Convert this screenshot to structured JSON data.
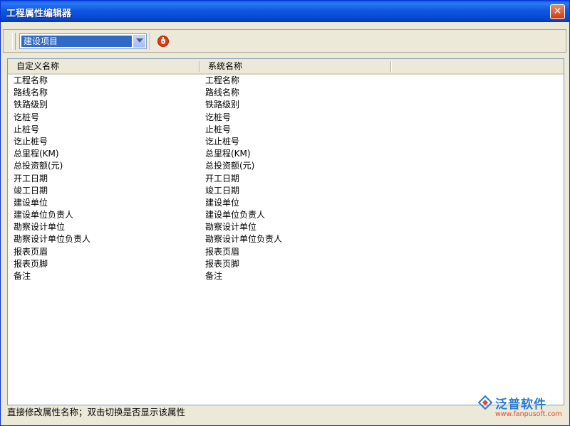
{
  "window": {
    "title": "工程属性编辑器"
  },
  "toolbar": {
    "selected_category": "建设项目"
  },
  "table": {
    "headers": [
      "自定义名称",
      "系统名称"
    ],
    "rows": [
      [
        "工程名称",
        "工程名称"
      ],
      [
        "路线名称",
        "路线名称"
      ],
      [
        "铁路级别",
        "铁路级别"
      ],
      [
        "讫桩号",
        "讫桩号"
      ],
      [
        "止桩号",
        "止桩号"
      ],
      [
        "讫止桩号",
        "讫止桩号"
      ],
      [
        "总里程(KM)",
        "总里程(KM)"
      ],
      [
        "总投资额(元)",
        "总投资额(元)"
      ],
      [
        "开工日期",
        "开工日期"
      ],
      [
        "竣工日期",
        "竣工日期"
      ],
      [
        "建设单位",
        "建设单位"
      ],
      [
        "建设单位负责人",
        "建设单位负责人"
      ],
      [
        "勘察设计单位",
        "勘察设计单位"
      ],
      [
        "勘察设计单位负责人",
        "勘察设计单位负责人"
      ],
      [
        "报表页眉",
        "报表页眉"
      ],
      [
        "报表页脚",
        "报表页脚"
      ],
      [
        "备注",
        "备注"
      ]
    ]
  },
  "status": {
    "text": "直接修改属性名称；双击切换是否显示该属性"
  },
  "watermark": {
    "brand": "泛普软件",
    "url": "www.fanpusoft.com"
  },
  "colors": {
    "selection": "#316ac5",
    "titlebar": "#0a5be0",
    "close": "#cd3b13",
    "logo": "#2a7bd1"
  },
  "icons": {
    "close": "close-icon",
    "dropdown": "chevron-down-icon",
    "stop": "power-icon"
  }
}
